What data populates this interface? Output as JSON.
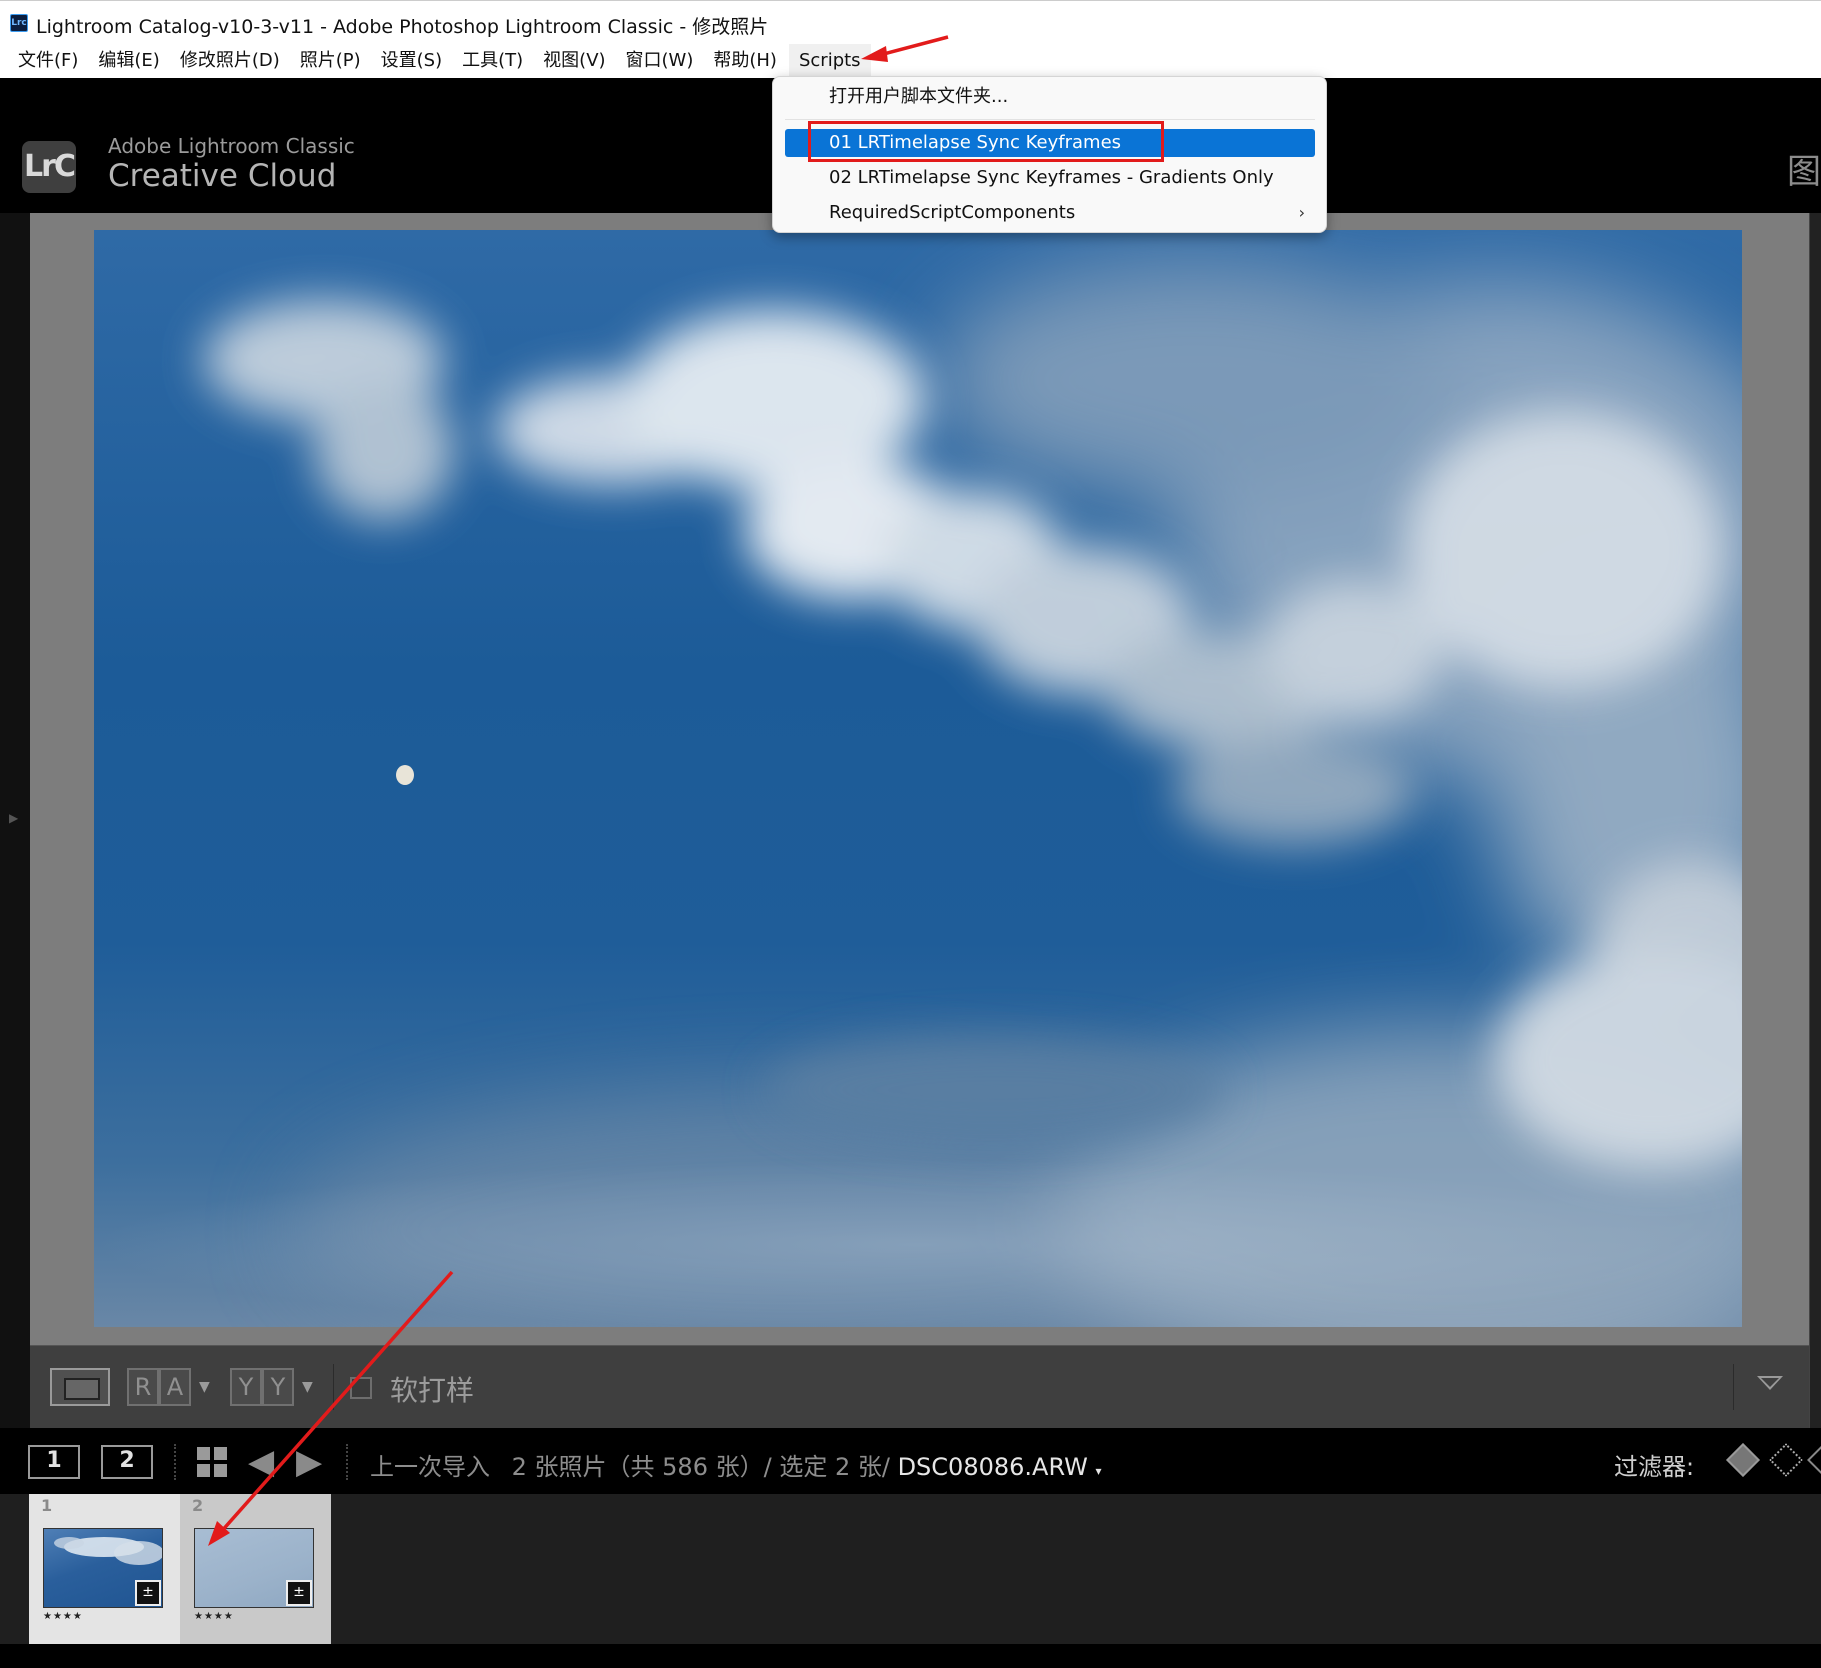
{
  "window": {
    "title": "Lightroom Catalog-v10-3-v11 - Adobe Photoshop Lightroom Classic - 修改照片",
    "icon_label": "Lrc"
  },
  "menubar": {
    "items": [
      "文件(F)",
      "编辑(E)",
      "修改照片(D)",
      "照片(P)",
      "设置(S)",
      "工具(T)",
      "视图(V)",
      "窗口(W)",
      "帮助(H)"
    ],
    "scripts_label": "Scripts"
  },
  "header": {
    "logo_text": "LrC",
    "brand_top": "Adobe Lightroom Classic",
    "brand_bottom": "Creative Cloud",
    "right_glyph": "图"
  },
  "scripts_menu": {
    "open_folder": "打开用户脚本文件夹...",
    "item_01": "01 LRTimelapse Sync Keyframes",
    "item_02": "02 LRTimelapse Sync Keyframes - Gradients Only",
    "required": "RequiredScriptComponents",
    "submenu_chevron": "›",
    "selected_index": 1
  },
  "toolbar": {
    "ra_left": "R",
    "ra_right": "A",
    "yy_left": "Y",
    "yy_right": "Y",
    "soft_proof_label": "软打样",
    "soft_proof_checked": false
  },
  "filmstrip_bar": {
    "screen_1": "1",
    "screen_2": "2",
    "source_prefix": "上一次导入",
    "source_count": "2 张照片（共 586 张）/ 选定 2 张/",
    "filename": "DSC08086.ARW",
    "filename_caret": "▾",
    "filter_label": "过滤器:"
  },
  "filmstrip": {
    "thumbs": [
      {
        "number": "1",
        "stars": "★★★★",
        "badge": "±"
      },
      {
        "number": "2",
        "stars": "★★★★",
        "badge": "±"
      }
    ]
  },
  "colors": {
    "menu_selection": "#0a74d6",
    "annotation_red": "#e21b1b",
    "canvas_gray": "#7d7d7d",
    "photo_sky": "#1c5b98"
  }
}
